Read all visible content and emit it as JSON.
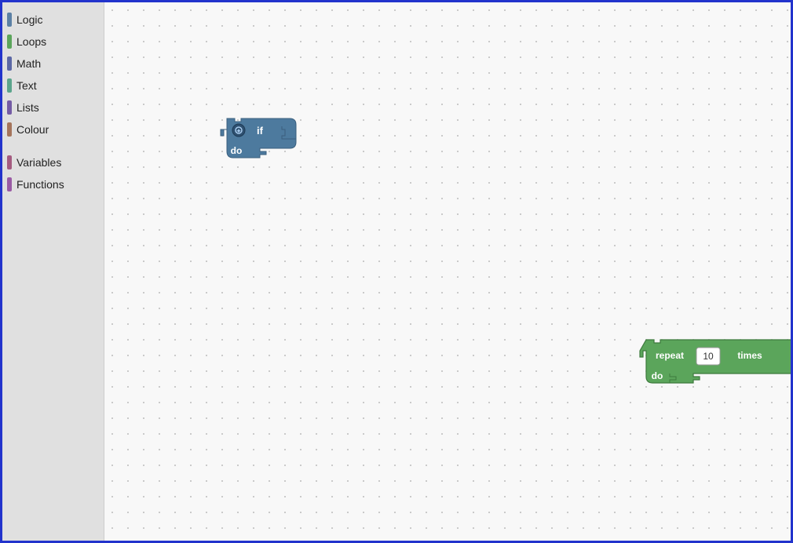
{
  "sidebar": {
    "items": [
      {
        "label": "Logic",
        "color": "#5b80a5"
      },
      {
        "label": "Loops",
        "color": "#5ba55b"
      },
      {
        "label": "Math",
        "color": "#5b67a5"
      },
      {
        "label": "Text",
        "color": "#5ba58c"
      },
      {
        "label": "Lists",
        "color": "#745ba5"
      },
      {
        "label": "Colour",
        "color": "#a5745b"
      },
      {
        "label": "Variables",
        "color": "#a55b80"
      },
      {
        "label": "Functions",
        "color": "#9a5ba5"
      }
    ]
  },
  "blocks": {
    "if_block": {
      "label_if": "if",
      "label_do": "do"
    },
    "repeat_block": {
      "label_repeat": "repeat",
      "label_times": "times",
      "label_do": "do",
      "value": "10"
    }
  }
}
